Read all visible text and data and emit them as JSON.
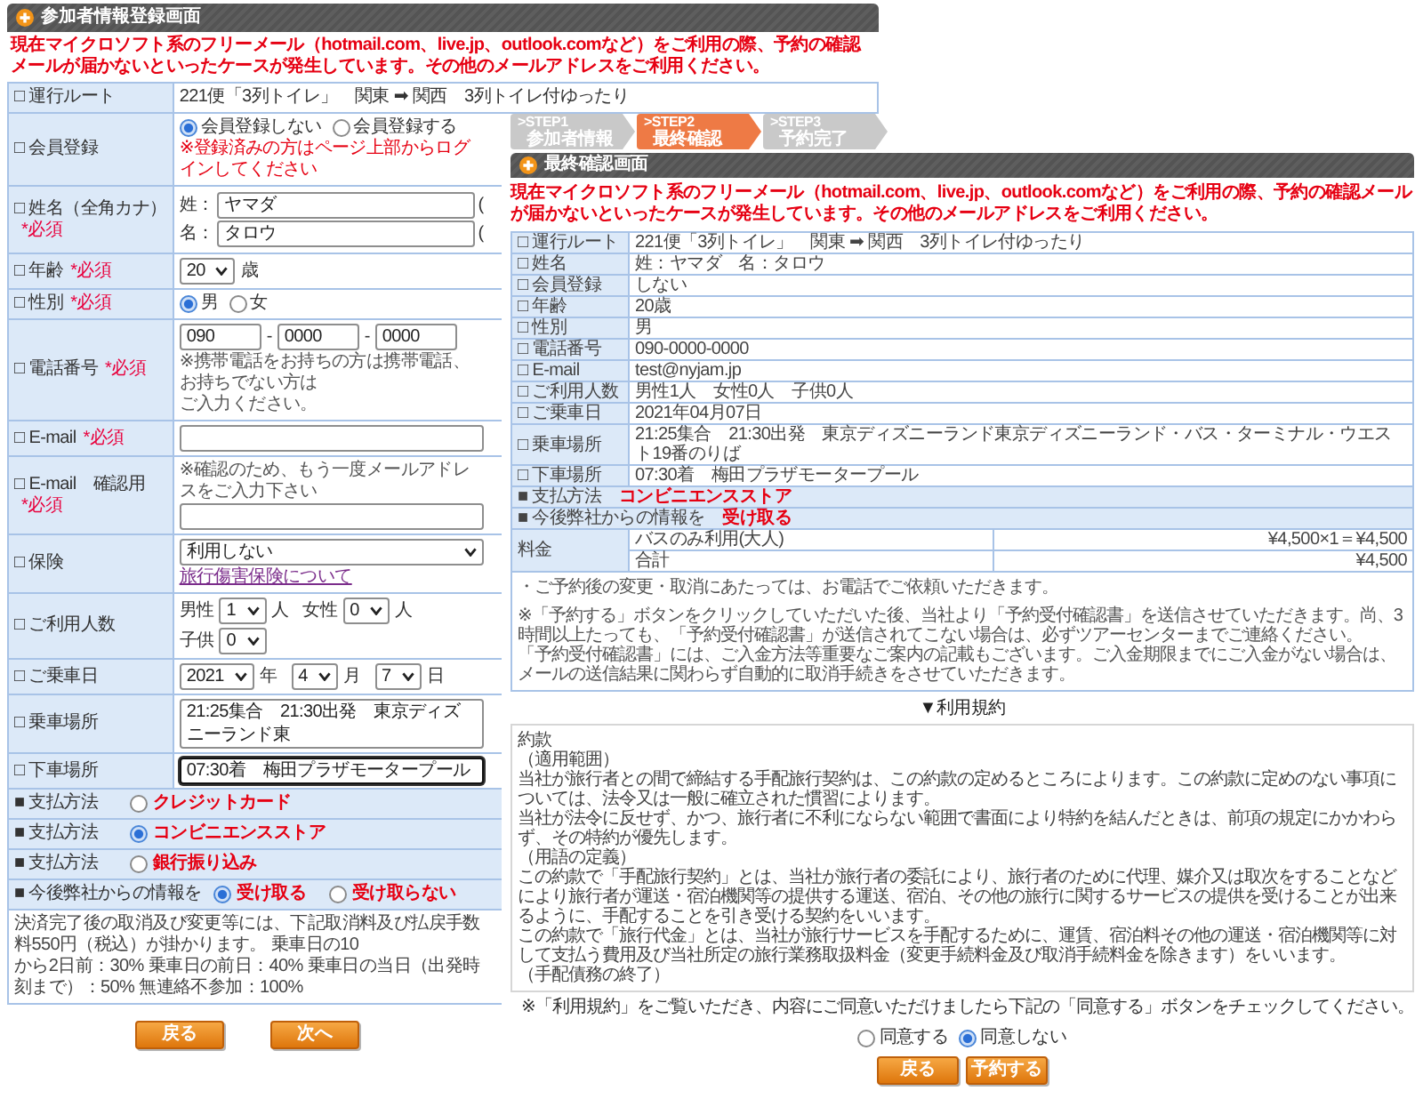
{
  "registration_window": {
    "title": "参加者情報登録画面",
    "notice": "現在マイクロソフト系のフリーメール（hotmail.com、live.jp、outlook.comなど）をご利用の際、予約の確認メールが届かないといったケースが発生しています。その他のメールアドレスをご利用ください。",
    "rows": [
      {
        "kind": "text",
        "label": "□ 運行ルート",
        "value": "221便「3列トイレ」　関東 ➡ 関西　3列トイレ付ゆったり"
      },
      {
        "kind": "radio",
        "label": "□ 会員登録",
        "options": [
          {
            "label": "会員登録しない",
            "selected": true
          },
          {
            "label": "会員登録する",
            "selected": false
          }
        ],
        "note": "※登録済みの方はページ上部からログインしてください"
      },
      {
        "kind": "name",
        "label": "□ 姓名（全角カナ）",
        "required": "*必須",
        "fields": [
          {
            "prefix": "姓：",
            "value": "ヤマダ",
            "hint": "("
          },
          {
            "prefix": "名：",
            "value": "タロウ",
            "hint": "("
          }
        ]
      },
      {
        "kind": "select",
        "label": "□ 年齢",
        "required": "*必須",
        "items": [
          {
            "value": "20",
            "unit": "歳"
          }
        ]
      },
      {
        "kind": "radio",
        "label": "□ 性別",
        "required": "*必須",
        "options": [
          {
            "label": "男",
            "selected": true
          },
          {
            "label": "女",
            "selected": false
          }
        ]
      },
      {
        "kind": "phone",
        "label": "□ 電話番号",
        "required": "*必須",
        "parts": [
          {
            "value": "090"
          },
          {
            "separator": "-",
            "value": "0000"
          },
          {
            "separator": "-",
            "value": "0000"
          }
        ],
        "notes": [
          "※携帯電話をお持ちの方は携帯電話、お持ちでない方は",
          "ご入力ください。"
        ]
      },
      {
        "kind": "input",
        "label": "□ E-mail",
        "required": "*必須",
        "focused": false
      },
      {
        "kind": "input",
        "label": "□ E-mail　確認用",
        "required": "*必須",
        "note": "※確認のため、もう一度メールアドレスをご入力下さい",
        "focused": false
      },
      {
        "kind": "dropdown",
        "label": "□ 保険",
        "value": "利用しない",
        "link": "旅行傷害保険について"
      },
      {
        "kind": "select",
        "label": "□ ご利用人数",
        "items": [
          {
            "label": "男性",
            "value": "1",
            "unit": "人"
          },
          {
            "label": "女性",
            "value": "0",
            "unit": "人"
          },
          {
            "label": "子供",
            "value": "0"
          }
        ]
      },
      {
        "kind": "select",
        "label": "□ ご乗車日",
        "items": [
          {
            "value": "2021",
            "unit": "年"
          },
          {
            "value": "4",
            "unit": "月"
          },
          {
            "value": "7",
            "unit": "日"
          }
        ]
      },
      {
        "kind": "input",
        "label": "□ 乗車場所",
        "value": "21:25集合　21:30出発　東京ディズニーランド東",
        "focused": false
      },
      {
        "kind": "input",
        "label": "□ 下車場所",
        "value": "07:30着　梅田プラザモータープール",
        "focused": true
      }
    ],
    "option_rows": [
      {
        "label": "■ 支払方法",
        "options": [
          {
            "label": "クレジットカード",
            "selected": false
          }
        ]
      },
      {
        "label": "■ 支払方法",
        "options": [
          {
            "label": "コンビニエンスストア",
            "selected": true
          }
        ]
      },
      {
        "label": "■ 支払方法",
        "options": [
          {
            "label": "銀行振り込み",
            "selected": false
          }
        ]
      },
      {
        "label": "■ 今後弊社からの情報を",
        "options": [
          {
            "label": "受け取る",
            "selected": true
          },
          {
            "label": "受け取らない",
            "selected": false
          }
        ]
      }
    ],
    "cancellation_note": [
      "決済完了後の取消及び変更等には、下記取消料及び払戻手数料550円（税込）が掛かります。 乗車日の10",
      "から2日前：30% 乗車日の前日：40% 乗車日の当日（出発時刻まで）：50% 無連絡不参加：100%"
    ],
    "buttons": [
      {
        "label": "戻る"
      },
      {
        "label": "次へ"
      }
    ]
  },
  "confirmation_window": {
    "steps": [
      {
        "label": ">STEP1",
        "caption": "参加者情報",
        "selected": false
      },
      {
        "label": ">STEP2",
        "caption": "最終確認",
        "selected": true
      },
      {
        "label": ">STEP3",
        "caption": "予約完了",
        "selected": false
      }
    ],
    "title": "最終確認画面",
    "notice": "現在マイクロソフト系のフリーメール（hotmail.com、live.jp、outlook.comなど）をご利用の際、予約の確認メールが届かないといったケースが発生しています。その他のメールアドレスをご利用ください。",
    "rows": [
      {
        "label": "□ 運行ルート",
        "value": "221便「3列トイレ」　関東 ➡ 関西　3列トイレ付ゆったり"
      },
      {
        "label": "□ 姓名",
        "value": "姓：ヤマダ　名：タロウ"
      },
      {
        "label": "□ 会員登録",
        "value": "しない"
      },
      {
        "label": "□ 年齢",
        "value": "20歳"
      },
      {
        "label": "□ 性別",
        "value": "男"
      },
      {
        "label": "□ 電話番号",
        "value": "090-0000-0000"
      },
      {
        "label": "□ E-mail",
        "value": "test@nyjam.jp"
      },
      {
        "label": "□ ご利用人数",
        "value": "男性1人　女性0人　子供0人"
      },
      {
        "label": "□ ご乗車日",
        "value": "2021年04月07日"
      },
      {
        "label": "□ 乗車場所",
        "value": "21:25集合　21:30出発　東京ディズニーランド東京ディズニーランド・バス・ターミナル・ウエスト19番のりば"
      },
      {
        "label": "□ 下車場所",
        "value": "07:30着　梅田プラザモータープール"
      }
    ],
    "summary_rows": [
      {
        "label": "■ 支払方法",
        "value": "コンビニエンスストア"
      },
      {
        "label": "■ 今後弊社からの情報を",
        "value": "受け取る"
      }
    ],
    "fare": {
      "label": "料金",
      "items": [
        {
          "name": "バスのみ利用(大人)",
          "amount": "¥4,500×1＝¥4,500"
        },
        {
          "name": "合計",
          "amount": "¥4,500"
        }
      ]
    },
    "notes": [
      "・ご予約後の変更・取消にあたっては、お電話でご依頼いただきます。",
      "※「予約する」ボタンをクリックしていただいた後、当社より「予約受付確認書」を送信させていただきます。尚、3時間以上たっても、「予約受付確認書」が送信されてこない場合は、必ずツアーセンターまでご連絡ください。",
      "「予約受付確認書」には、ご入金方法等重要なご案内の記載もございます。ご入金期限までにご入金がない場合は、メールの送信結果に関わらず自動的に取消手続きをさせていただきます。"
    ],
    "terms_title": "▼利用規約",
    "terms": [
      "約款",
      "（適用範囲）",
      "当社が旅行者との間で締結する手配旅行契約は、この約款の定めるところによります。この約款に定めのない事項については、法令又は一般に確立された慣習によります。",
      "当社が法令に反せず、かつ、旅行者に不利にならない範囲で書面により特約を結んだときは、前項の規定にかかわらず、その特約が優先します。",
      "（用語の定義）",
      "この約款で「手配旅行契約」とは、当社が旅行者の委託により、旅行者のために代理、媒介又は取次をすることなどにより旅行者が運送・宿泊機関等の提供する運送、宿泊、その他の旅行に関するサービスの提供を受けることが出来るように、手配することを引き受ける契約をいいます。",
      "この約款で「旅行代金」とは、当社が旅行サービスを手配するために、運賃、宿泊料その他の運送・宿泊機関等に対して支払う費用及び当社所定の旅行業務取扱料金（変更手続料金及び取消手続料金を除きます）をいいます。",
      "（手配債務の終了）"
    ],
    "agreement_note": "※「利用規約」をご覧いただき、内容にご同意いただけましたら下記の「同意する」ボタンをチェックしてください。",
    "agreement_options": [
      {
        "label": "同意する",
        "selected": false
      },
      {
        "label": "同意しない",
        "selected": true
      }
    ],
    "buttons": [
      {
        "label": "戻る"
      },
      {
        "label": "予約する"
      }
    ]
  }
}
